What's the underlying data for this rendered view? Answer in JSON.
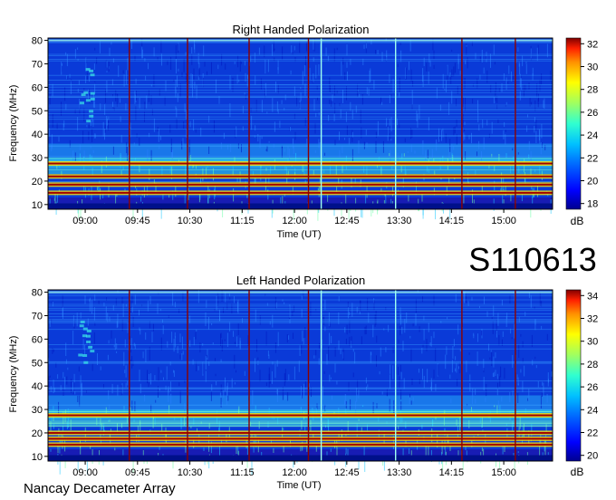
{
  "figure": {
    "id_label": "S110613",
    "footer": "Nancay Decameter Array"
  },
  "colors": {
    "colormap": [
      "#00008f",
      "#0000ff",
      "#0060ff",
      "#00c0ff",
      "#30ffd0",
      "#a0ff60",
      "#ffff00",
      "#ff9000",
      "#ff2000",
      "#800000"
    ],
    "vertical_line_red": "#8b0000",
    "vertical_line_cyan": "#9ffff0",
    "background_blue": "#0a3ad8"
  },
  "chart_data": [
    {
      "type": "heatmap",
      "title": "Right Handed Polarization",
      "xlabel": "Time (UT)",
      "ylabel": "Frequency (MHz)",
      "x_ticks": [
        "09:00",
        "09:45",
        "10:30",
        "11:15",
        "12:00",
        "12:45",
        "13:30",
        "14:15",
        "15:00"
      ],
      "y_ticks": [
        10,
        20,
        30,
        40,
        50,
        60,
        70,
        80
      ],
      "ylim": [
        8,
        81
      ],
      "colorbar": {
        "label": "dB",
        "ticks": [
          18,
          20,
          22,
          24,
          26,
          28,
          30,
          32
        ],
        "range": [
          17.5,
          32.5
        ]
      },
      "bands": [
        {
          "freq_mhz": 27.5,
          "level": "high"
        },
        {
          "freq_mhz": 22,
          "level": "high"
        },
        {
          "freq_mhz": 18.5,
          "level": "high"
        },
        {
          "freq_mhz": 15,
          "level": "high"
        }
      ],
      "vertical_lines_red": [
        "09:38",
        "10:28",
        "11:21",
        "12:12",
        "14:24",
        "15:10"
      ],
      "vertical_lines_cyan": [
        "12:23",
        "13:27"
      ]
    },
    {
      "type": "heatmap",
      "title": "Left Handed Polarization",
      "xlabel": "Time (UT)",
      "ylabel": "Frequency (MHz)",
      "x_ticks": [
        "09:00",
        "09:45",
        "10:30",
        "11:15",
        "12:00",
        "12:45",
        "13:30",
        "14:15",
        "15:00"
      ],
      "y_ticks": [
        10,
        20,
        30,
        40,
        50,
        60,
        70,
        80
      ],
      "ylim": [
        8,
        81
      ],
      "colorbar": {
        "label": "dB",
        "ticks": [
          20,
          22,
          24,
          26,
          28,
          30,
          32,
          34
        ],
        "range": [
          19.5,
          34.5
        ]
      },
      "bands": [
        {
          "freq_mhz": 27.5,
          "level": "high"
        },
        {
          "freq_mhz": 20,
          "level": "high"
        },
        {
          "freq_mhz": 17.5,
          "level": "high"
        },
        {
          "freq_mhz": 15,
          "level": "high"
        }
      ],
      "vertical_lines_red": [
        "09:38",
        "10:28",
        "11:21",
        "12:12",
        "14:24",
        "15:10"
      ],
      "vertical_lines_cyan": [
        "12:23",
        "13:27"
      ]
    }
  ]
}
